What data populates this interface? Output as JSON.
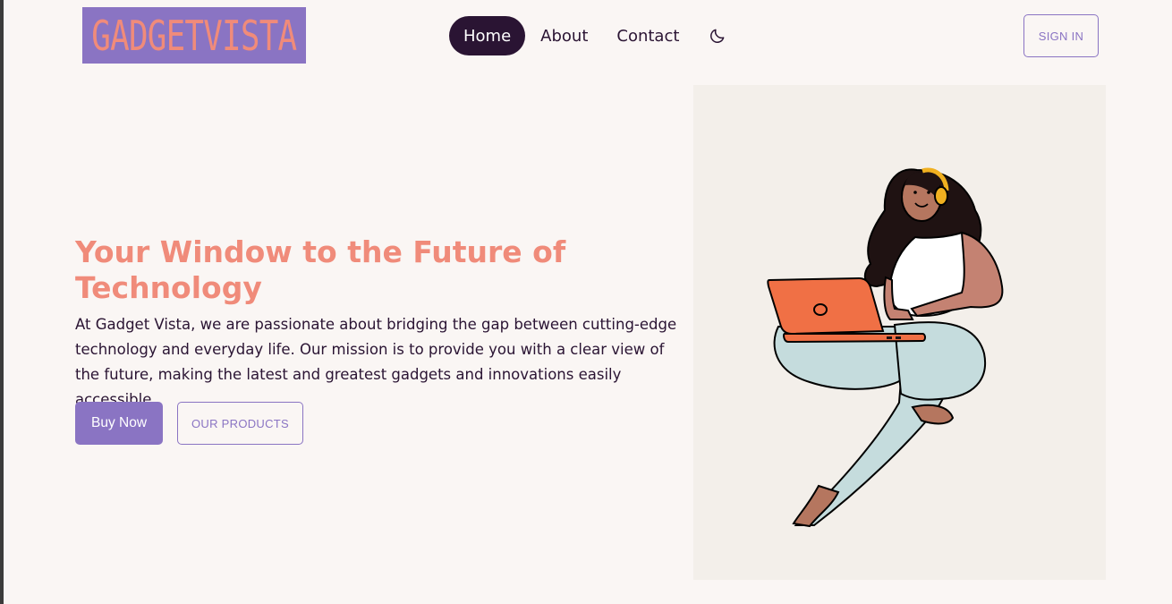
{
  "header": {
    "logo_text": "GADGETVISTA",
    "nav": [
      {
        "label": "Home",
        "active": true
      },
      {
        "label": "About",
        "active": false
      },
      {
        "label": "Contact",
        "active": false
      }
    ],
    "theme_icon": "moon-icon",
    "signin_label": "SIGN IN"
  },
  "hero": {
    "title": "Your Window to the Future of Technology",
    "description": "At Gadget Vista, we are passionate about bridging the gap between cutting-edge technology and everyday life. Our mission is to provide you with a clear view of the future, making the latest and greatest gadgets and innovations easily accessible.",
    "buy_label": "Buy Now",
    "products_label": "OUR PRODUCTS"
  },
  "colors": {
    "accent": "#8a74c3",
    "title": "#f08b7a",
    "dark": "#2a1433",
    "background": "#faf6f4"
  }
}
